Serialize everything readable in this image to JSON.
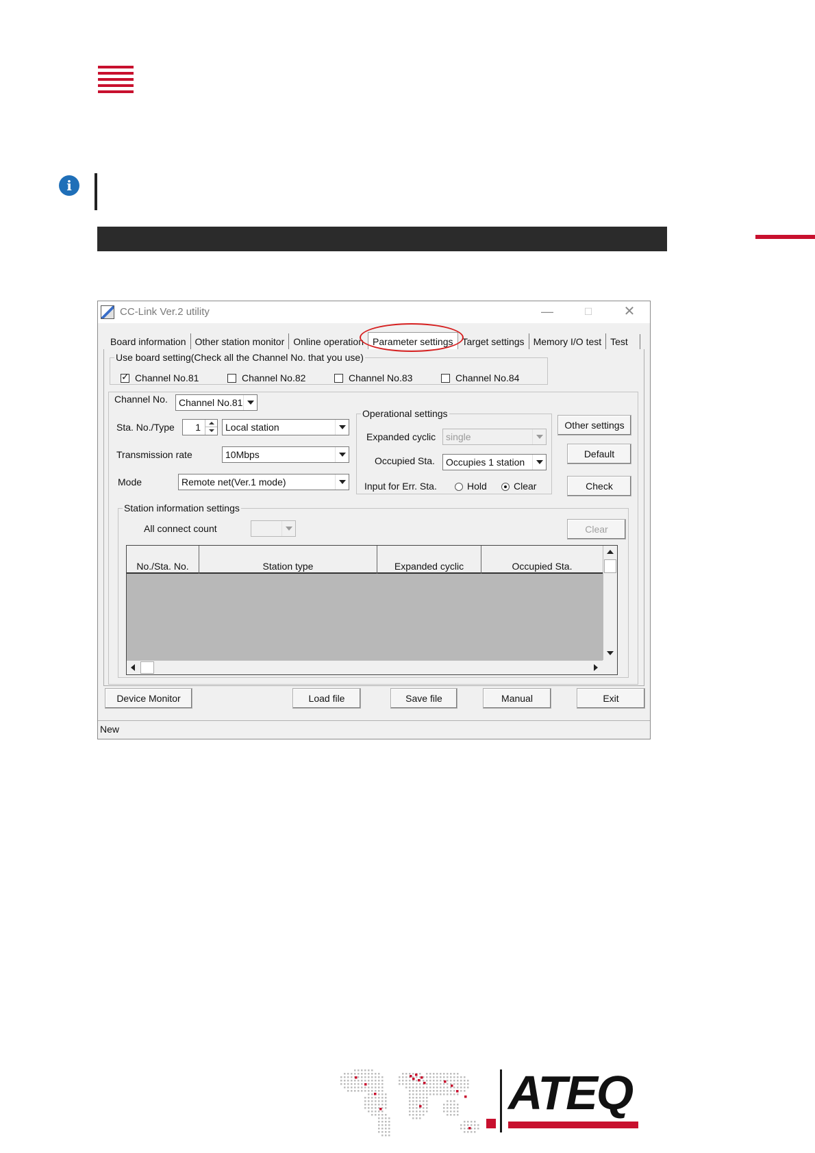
{
  "window": {
    "title": "CC-Link Ver.2 utility",
    "minimize_symbol": "—",
    "maximize_symbol": "☐",
    "close_symbol": "✕"
  },
  "tabs": [
    {
      "label": "Board information"
    },
    {
      "label": "Other station monitor"
    },
    {
      "label": "Online operation"
    },
    {
      "label": "Parameter settings"
    },
    {
      "label": "Target settings"
    },
    {
      "label": "Memory I/O test"
    },
    {
      "label": "Test"
    }
  ],
  "board_setting": {
    "legend": "Use board setting(Check all the Channel No. that you use)",
    "channels": [
      {
        "label": "Channel No.81",
        "checked": true
      },
      {
        "label": "Channel No.82",
        "checked": false
      },
      {
        "label": "Channel No.83",
        "checked": false
      },
      {
        "label": "Channel No.84",
        "checked": false
      }
    ]
  },
  "channel_no": {
    "label": "Channel No.",
    "value": "Channel No.81"
  },
  "station": {
    "sta_label": "Sta. No./Type",
    "sta_no": "1",
    "type_value": "Local station",
    "transmission_label": "Transmission rate",
    "transmission_value": "10Mbps",
    "mode_label": "Mode",
    "mode_value": "Remote net(Ver.1 mode)"
  },
  "operational": {
    "legend": "Operational settings",
    "expanded_label": "Expanded cyclic",
    "expanded_value": "single",
    "occupied_label": "Occupied Sta.",
    "occupied_value": "Occupies 1 station",
    "input_err_label": "Input for Err. Sta.",
    "hold_label": "Hold",
    "clear_label": "Clear",
    "selected": "Clear"
  },
  "side_buttons": {
    "other_settings": "Other settings",
    "default": "Default",
    "check": "Check"
  },
  "station_info": {
    "legend": "Station information settings",
    "all_connect_label": "All connect count",
    "all_connect_value": "",
    "clear_button": "Clear",
    "columns": [
      "No./Sta. No.",
      "Station type",
      "Expanded cyclic",
      "Occupied Sta."
    ]
  },
  "bottom_buttons": {
    "device_monitor": "Device Monitor",
    "load_file": "Load file",
    "save_file": "Save file",
    "manual": "Manual",
    "exit": "Exit"
  },
  "status_bar": {
    "text": "New"
  },
  "page": {
    "info_icon_glyph": "i",
    "logo_text": "ATEQ",
    "colors": {
      "brand_red": "#c8102e",
      "info_blue": "#1f6fb8",
      "band_dark": "#2b2b2b",
      "highlight_red": "#d62020"
    }
  }
}
